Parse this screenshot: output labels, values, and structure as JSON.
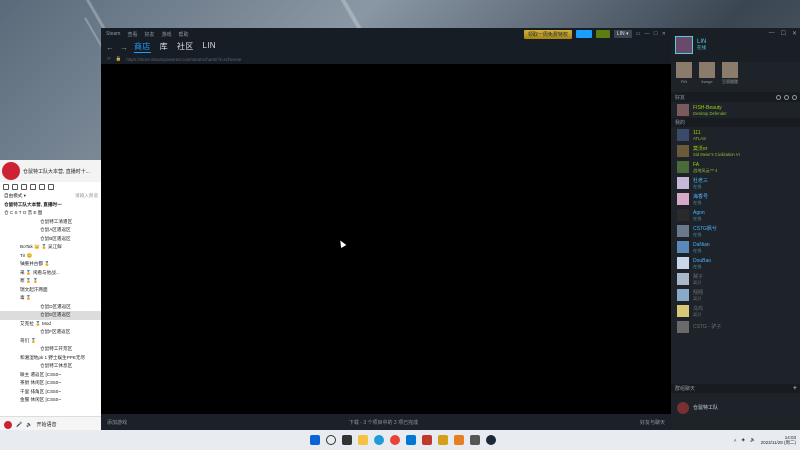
{
  "left_app": {
    "channel_title": "仓鼠特工队大本营, 直播时十...",
    "mode_label": "自由模式 ▾",
    "nav_hint": "请输入频道",
    "rows": [
      {
        "text": "仓鼠特工队大本营, 直播时一",
        "style": "bold"
      },
      {
        "text": "仓 C S T O 音 E 图",
        "style": "normal"
      },
      {
        "text": "仓鼠特工清遣区",
        "style": "indent"
      },
      {
        "text": "仓鼠A区遣返区",
        "style": "indent"
      },
      {
        "text": "仓鼠B区遣返区",
        "style": "indent"
      },
      {
        "text": "BoTak 👑 🏅 吴江鲜",
        "style": "indent2"
      },
      {
        "text": "Tir 😊",
        "style": "indent2"
      },
      {
        "text": "铀重井古都 🏅",
        "style": "indent2"
      },
      {
        "text": "来 🏅 闲看与他战...",
        "style": "indent2"
      },
      {
        "text": "寒 🏅 🏅",
        "style": "indent2"
      },
      {
        "text": "瑞文起汗两面",
        "style": "indent2"
      },
      {
        "text": "毒 🏅",
        "style": "indent2"
      },
      {
        "text": "仓鼠D区遣返区",
        "style": "indent"
      },
      {
        "text": "仓鼠E区遣返区",
        "style": "indent sel"
      },
      {
        "text": "艾克拉 🏅 Mod",
        "style": "indent2"
      },
      {
        "text": "仓鼠F区遣返区",
        "style": "indent"
      },
      {
        "text": "哥们 🏅",
        "style": "indent2"
      },
      {
        "text": "仓鼠特工开荒区",
        "style": "indent"
      },
      {
        "text": "和湘湿地pk 1 野士娱生PPE无尽",
        "style": "indent2"
      },
      {
        "text": "仓鼠特工休息区",
        "style": "indent"
      },
      {
        "text": "联主 遣返区 [CS50~",
        "style": "indent2"
      },
      {
        "text": "茶厨 休闲区 [CS50~",
        "style": "indent2"
      },
      {
        "text": "千里 排角区 [CS50~",
        "style": "indent2"
      },
      {
        "text": "金服 休闲区 [CS50~",
        "style": "indent2"
      }
    ],
    "bottom_text": "开始语音"
  },
  "steam": {
    "titlebar": {
      "menu": [
        "Steam",
        "查看",
        "好友",
        "游戏",
        "帮助"
      ],
      "promo_button": "领取一周免费特权",
      "user_label": "LIN ▾"
    },
    "nav": {
      "tabs": [
        "商店",
        "库",
        "社区",
        "LIN"
      ],
      "active_tab": "商店"
    },
    "url": "https://store.steampowered.com/steamcharts/?l=schinese",
    "footer": {
      "add_game": "添加游戏",
      "downloads": "下载 - 3 个项目中的 3 项已完成",
      "friends_chat": "好友与聊天"
    }
  },
  "friends": {
    "me": {
      "name": "LIN",
      "status": "在线"
    },
    "recent": [
      {
        "label": "FiN"
      },
      {
        "label": "lbarge"
      },
      {
        "label": "豆腐酸酸"
      }
    ],
    "section_label": "好友",
    "top_friend": {
      "name": "FISH-Beauty",
      "game": "Desktop Defender"
    },
    "group_label": "我的",
    "list": [
      {
        "name": "111",
        "game": "ATLAS",
        "state": "ingame",
        "color": "#3a4a6a"
      },
      {
        "name": "莫沃er",
        "game": "Sid Meier's Civilization VI",
        "state": "ingame",
        "color": "#6a5a3a"
      },
      {
        "name": "FA",
        "game": "战地风云™ 4",
        "state": "ingame",
        "color": "#4a6a3a"
      },
      {
        "name": "杜老三",
        "game": "在线",
        "state": "online",
        "color": "#c8b8d8"
      },
      {
        "name": "海香号",
        "game": "在线",
        "state": "online",
        "color": "#d8a8c8"
      },
      {
        "name": "Agon",
        "game": "在线",
        "state": "online",
        "color": "#2a2a2a"
      },
      {
        "name": "CSTG枫兮",
        "game": "在线",
        "state": "online",
        "color": "#6a7a8a"
      },
      {
        "name": "DaNian",
        "game": "在线",
        "state": "online",
        "color": "#5a8aba"
      },
      {
        "name": "DouBao",
        "game": "在线",
        "state": "online",
        "color": "#c8d8e8"
      },
      {
        "name": "贼子",
        "game": "离开",
        "state": "offline",
        "color": "#a8b8c8"
      },
      {
        "name": "翔翔",
        "game": "离开",
        "state": "offline",
        "color": "#8aa8c8"
      },
      {
        "name": "乌鸡",
        "game": "离开",
        "state": "offline",
        "color": "#d8c87a"
      },
      {
        "name": "CSTG - 驴子",
        "game": "",
        "state": "offline",
        "color": "#6a6a6a"
      }
    ],
    "chat_group_label": "群组聊天",
    "chat_group": {
      "name": "仓鼠特工队"
    }
  },
  "taskbar": {
    "time": "14:03",
    "date": "2023/11/28 (周二)"
  }
}
